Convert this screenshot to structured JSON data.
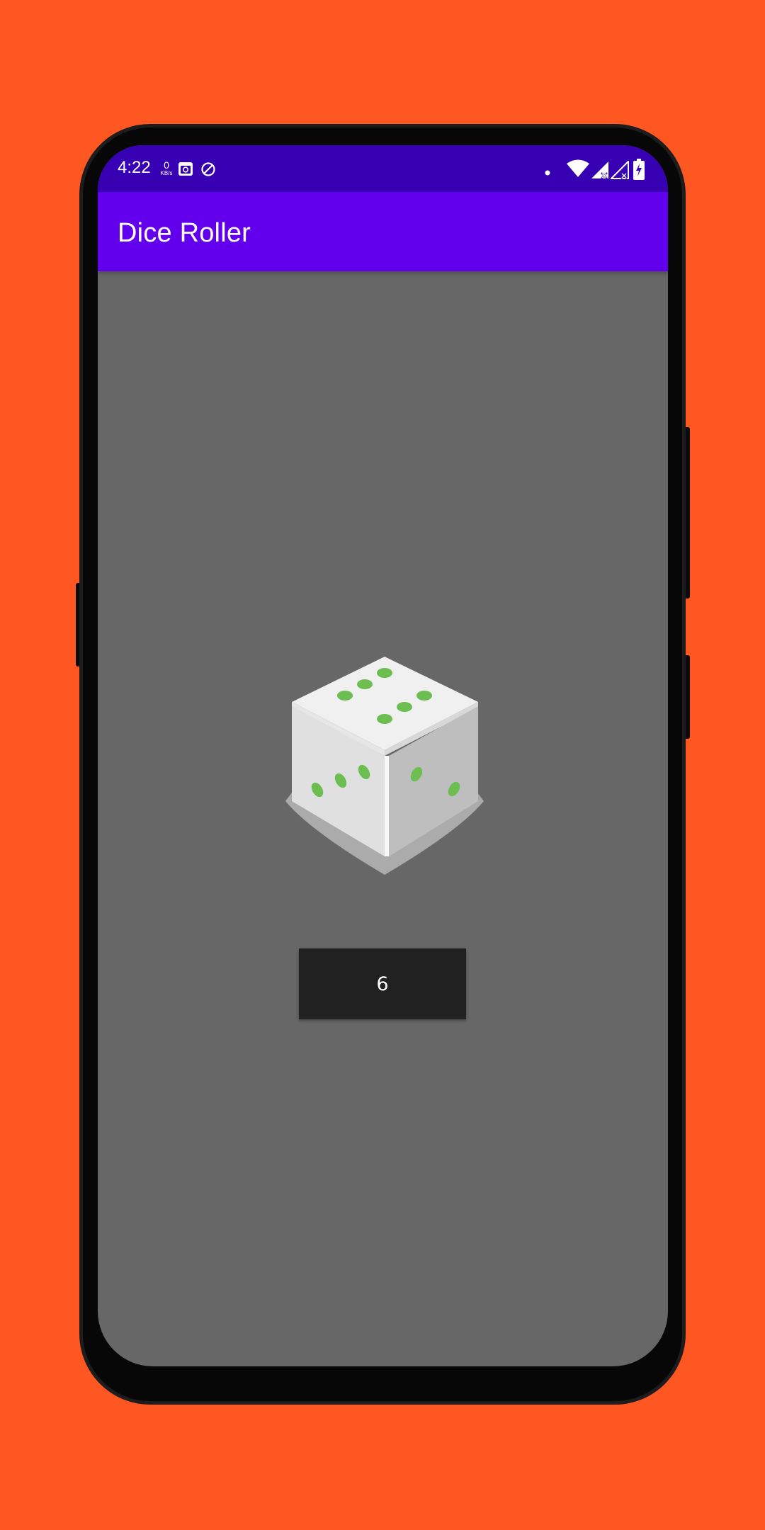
{
  "status_bar": {
    "time": "4:22",
    "net_speed_value": "0",
    "net_speed_unit": "KB/s",
    "left_icons": [
      "calendar-icon",
      "do-not-disturb-icon"
    ],
    "right_icons": [
      "notification-dot-icon",
      "wifi-icon",
      "signal-icon",
      "signal-no-service-icon",
      "battery-charging-icon"
    ]
  },
  "app_bar": {
    "title": "Dice Roller"
  },
  "main": {
    "dice_icon": "dice-icon",
    "roll_button_label": "6"
  },
  "colors": {
    "background": "#FF5722",
    "status_bar": "#3700B3",
    "app_bar": "#6200EE",
    "screen_background": "#676767",
    "button": "#212121",
    "dice_pips": "#6BBE4F"
  }
}
